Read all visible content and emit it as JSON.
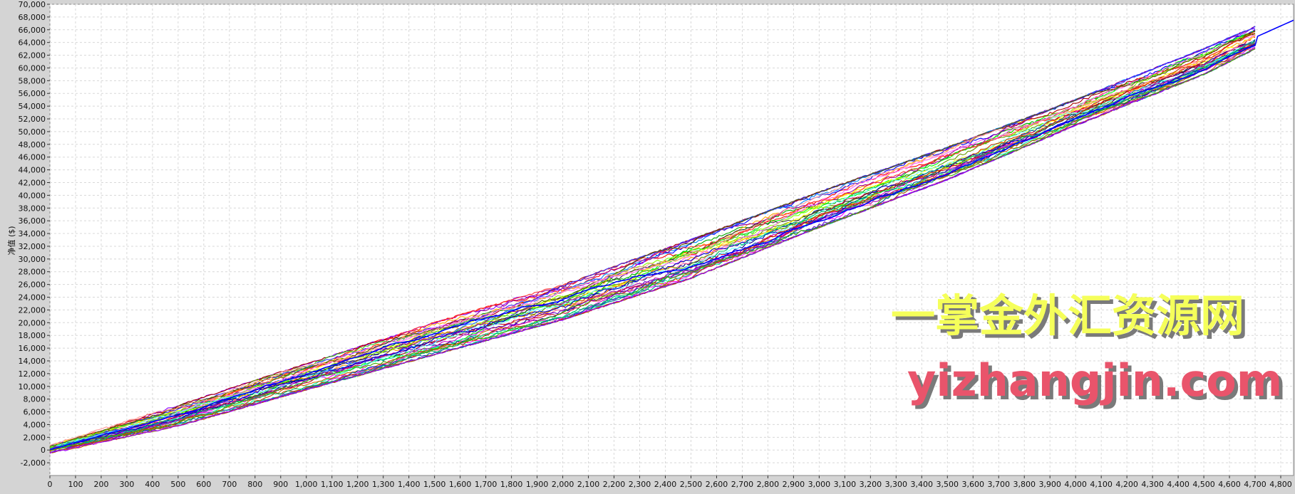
{
  "chart_data": {
    "type": "line",
    "title": "",
    "xlabel": "",
    "ylabel": "净值 ($)",
    "xlim": [
      0,
      4850
    ],
    "ylim": [
      -4000,
      70000
    ],
    "x_ticks": [
      0,
      100,
      200,
      300,
      400,
      500,
      600,
      700,
      800,
      900,
      1000,
      1100,
      1200,
      1300,
      1400,
      1500,
      1600,
      1700,
      1800,
      1900,
      2000,
      2100,
      2200,
      2300,
      2400,
      2500,
      2600,
      2700,
      2800,
      2900,
      3000,
      3100,
      3200,
      3300,
      3400,
      3500,
      3600,
      3700,
      3800,
      3900,
      4000,
      4100,
      4200,
      4300,
      4400,
      4500,
      4600,
      4700,
      4800
    ],
    "x_tick_labels": [
      "0",
      "100",
      "200",
      "300",
      "400",
      "500",
      "600",
      "700",
      "800",
      "900",
      "1,000",
      "1,100",
      "1,200",
      "1,300",
      "1,400",
      "1,500",
      "1,600",
      "1,700",
      "1,800",
      "1,900",
      "2,000",
      "2,100",
      "2,200",
      "2,300",
      "2,400",
      "2,500",
      "2,600",
      "2,700",
      "2,800",
      "2,900",
      "3,000",
      "3,100",
      "3,200",
      "3,300",
      "3,400",
      "3,500",
      "3,600",
      "3,700",
      "3,800",
      "3,900",
      "4,000",
      "4,100",
      "4,200",
      "4,300",
      "4,400",
      "4,500",
      "4,600",
      "4,700",
      "4,800"
    ],
    "y_ticks": [
      -2000,
      0,
      2000,
      4000,
      6000,
      8000,
      10000,
      12000,
      14000,
      16000,
      18000,
      20000,
      22000,
      24000,
      26000,
      28000,
      30000,
      32000,
      34000,
      36000,
      38000,
      40000,
      42000,
      44000,
      46000,
      48000,
      50000,
      52000,
      54000,
      56000,
      58000,
      60000,
      62000,
      64000,
      66000,
      68000,
      70000
    ],
    "y_tick_labels": [
      "-2,000",
      "0",
      "2,000",
      "4,000",
      "6,000",
      "8,000",
      "10,000",
      "12,000",
      "14,000",
      "16,000",
      "18,000",
      "20,000",
      "22,000",
      "24,000",
      "26,000",
      "28,000",
      "30,000",
      "32,000",
      "34,000",
      "36,000",
      "38,000",
      "40,000",
      "42,000",
      "44,000",
      "46,000",
      "48,000",
      "50,000",
      "52,000",
      "54,000",
      "56,000",
      "58,000",
      "60,000",
      "62,000",
      "64,000",
      "66,000",
      "68,000",
      "70,000"
    ],
    "grid": true,
    "legend": "none",
    "series_colors": [
      "#ff0000",
      "#0000ff",
      "#00aa00",
      "#ff00ff",
      "#00cccc",
      "#ffaa00",
      "#8800ff",
      "#00ff00",
      "#aa0000",
      "#000088",
      "#ff6699",
      "#669900",
      "#ff8800",
      "#0088ff",
      "#990099",
      "#00ff99",
      "#333333",
      "#ffff00",
      "#996633",
      "#ff3333",
      "#3333ff",
      "#33cc33",
      "#cc00cc",
      "#009999",
      "#cc6600",
      "#6600cc",
      "#88ff00",
      "#cc0033",
      "#0055aa",
      "#aa5500",
      "#ff66ff",
      "#66ffff",
      "#555500",
      "#aa00aa",
      "#0000cc",
      "#cc3300",
      "#00bb66",
      "#9900ff",
      "#ff9999",
      "#44aa00"
    ],
    "series_count": 40,
    "series_endpoints": {
      "x_start": 0,
      "y_start": 0,
      "x_end": 4700,
      "y_end_range": [
        63000,
        66500
      ],
      "longest_series": {
        "color": "#0000ff",
        "x_end": 4850,
        "y_end": 67500
      }
    },
    "series_band": [
      {
        "x": 0,
        "y_low": -500,
        "y_high": 800
      },
      {
        "x": 500,
        "y_low": 3800,
        "y_high": 7000
      },
      {
        "x": 1000,
        "y_low": 9500,
        "y_high": 13500
      },
      {
        "x": 1500,
        "y_low": 15000,
        "y_high": 20000
      },
      {
        "x": 2000,
        "y_low": 20500,
        "y_high": 26000
      },
      {
        "x": 2500,
        "y_low": 27000,
        "y_high": 33000
      },
      {
        "x": 3000,
        "y_low": 35000,
        "y_high": 40500
      },
      {
        "x": 3500,
        "y_low": 42500,
        "y_high": 47500
      },
      {
        "x": 4000,
        "y_low": 51000,
        "y_high": 55000
      },
      {
        "x": 4500,
        "y_low": 59000,
        "y_high": 63000
      },
      {
        "x": 4700,
        "y_low": 63000,
        "y_high": 66500
      }
    ]
  },
  "watermark": {
    "line1": "一掌金外汇资源网",
    "line1_color": "#f5ff5a",
    "line2": "yizhangjin.com",
    "line2_color": "#e9546b",
    "shadow_color": "#7a7a7a"
  },
  "colors": {
    "page_bg": "#d4d4d4",
    "plot_bg": "#ffffff",
    "grid": "#d8d8d8"
  }
}
